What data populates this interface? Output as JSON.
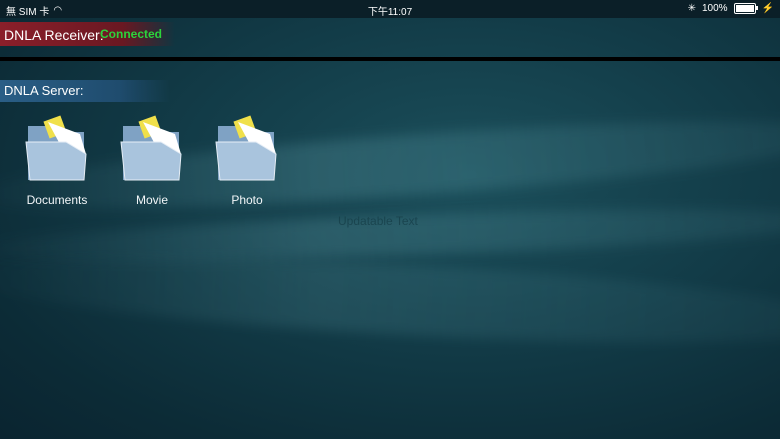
{
  "status_bar": {
    "carrier": "無 SIM 卡",
    "time": "下午11:07",
    "battery_percent": "100%",
    "battery_level": 1.0
  },
  "receiver": {
    "label": "DNLA Receiver:",
    "status": "Connected",
    "status_color": "#2bd43b"
  },
  "server": {
    "label": "DNLA Server:",
    "folders": [
      {
        "label": "Documents"
      },
      {
        "label": "Movie"
      },
      {
        "label": "Photo"
      }
    ]
  },
  "faint_text": "Updatable Text"
}
